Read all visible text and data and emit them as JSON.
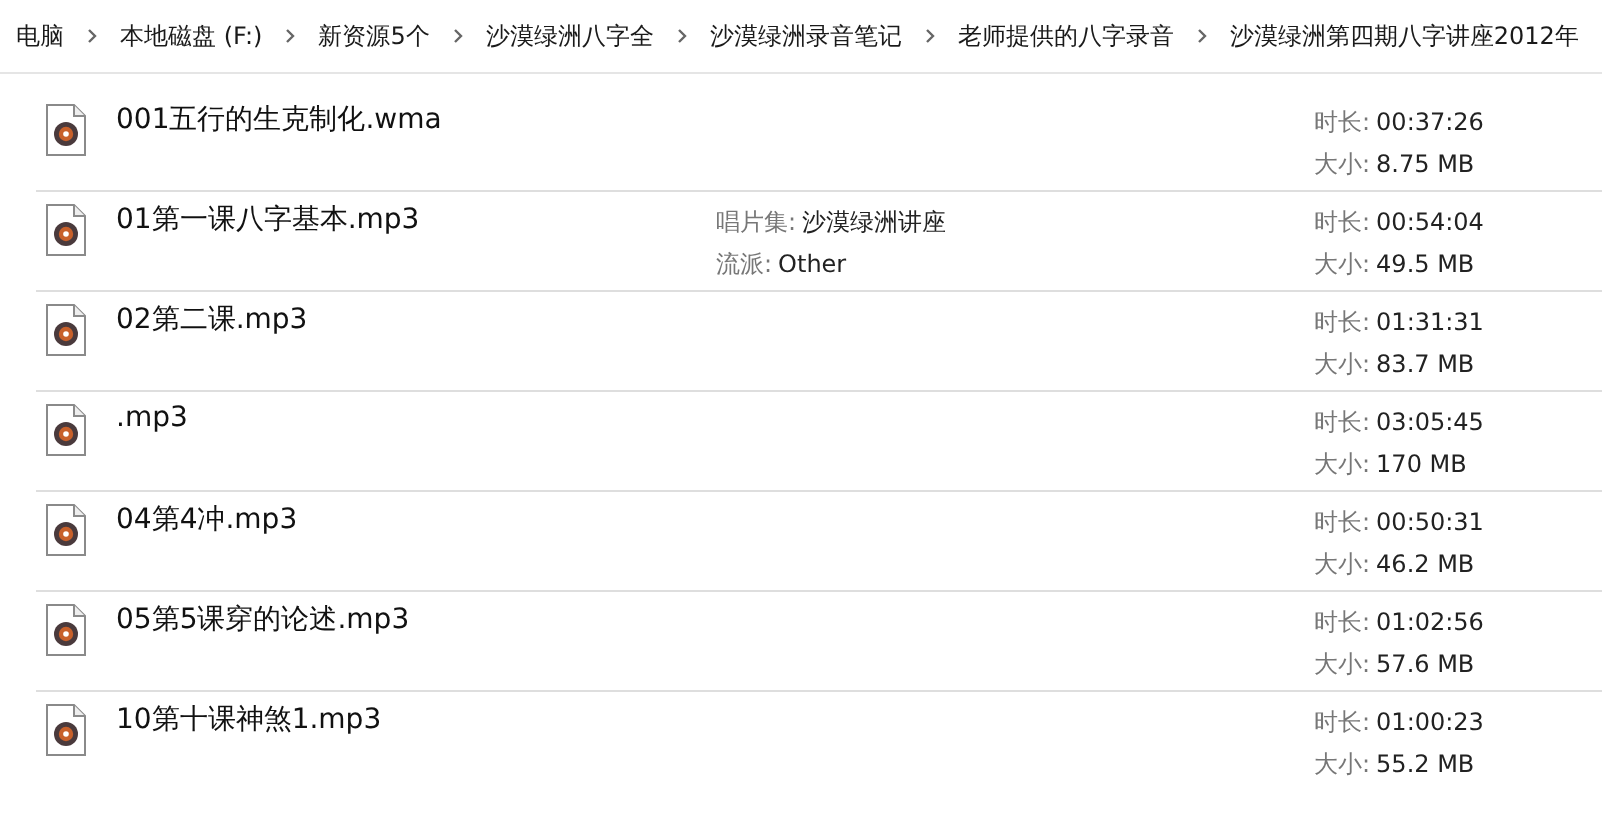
{
  "breadcrumb": [
    "电脑",
    "本地磁盘 (F:)",
    "新资源5个",
    "沙漠绿洲八字全",
    "沙漠绿洲录音笔记",
    "老师提供的八字录音",
    "沙漠绿洲第四期八字讲座2012年"
  ],
  "files": [
    {
      "name": "001五行的生克制化.wma",
      "duration": {
        "label": "时长:",
        "value": "00:37:26"
      },
      "size": {
        "label": "大小:",
        "value": "8.75 MB"
      }
    },
    {
      "name": "01第一课八字基本.mp3",
      "details": [
        {
          "label": "唱片集:",
          "value": "沙漠绿洲讲座"
        },
        {
          "label": "流派:",
          "value": "Other"
        }
      ],
      "duration": {
        "label": "时长:",
        "value": "00:54:04"
      },
      "size": {
        "label": "大小:",
        "value": "49.5 MB"
      }
    },
    {
      "name": "02第二课.mp3",
      "duration": {
        "label": "时长:",
        "value": "01:31:31"
      },
      "size": {
        "label": "大小:",
        "value": "83.7 MB"
      }
    },
    {
      "name": ".mp3",
      "duration": {
        "label": "时长:",
        "value": "03:05:45"
      },
      "size": {
        "label": "大小:",
        "value": "170 MB"
      }
    },
    {
      "name": "04第4冲.mp3",
      "duration": {
        "label": "时长:",
        "value": "00:50:31"
      },
      "size": {
        "label": "大小:",
        "value": "46.2 MB"
      }
    },
    {
      "name": "05第5课穿的论述.mp3",
      "duration": {
        "label": "时长:",
        "value": "01:02:56"
      },
      "size": {
        "label": "大小:",
        "value": "57.6 MB"
      }
    },
    {
      "name": "10第十课神煞1.mp3",
      "duration": {
        "label": "时长:",
        "value": "01:00:23"
      },
      "size": {
        "label": "大小:",
        "value": "55.2 MB"
      }
    }
  ]
}
